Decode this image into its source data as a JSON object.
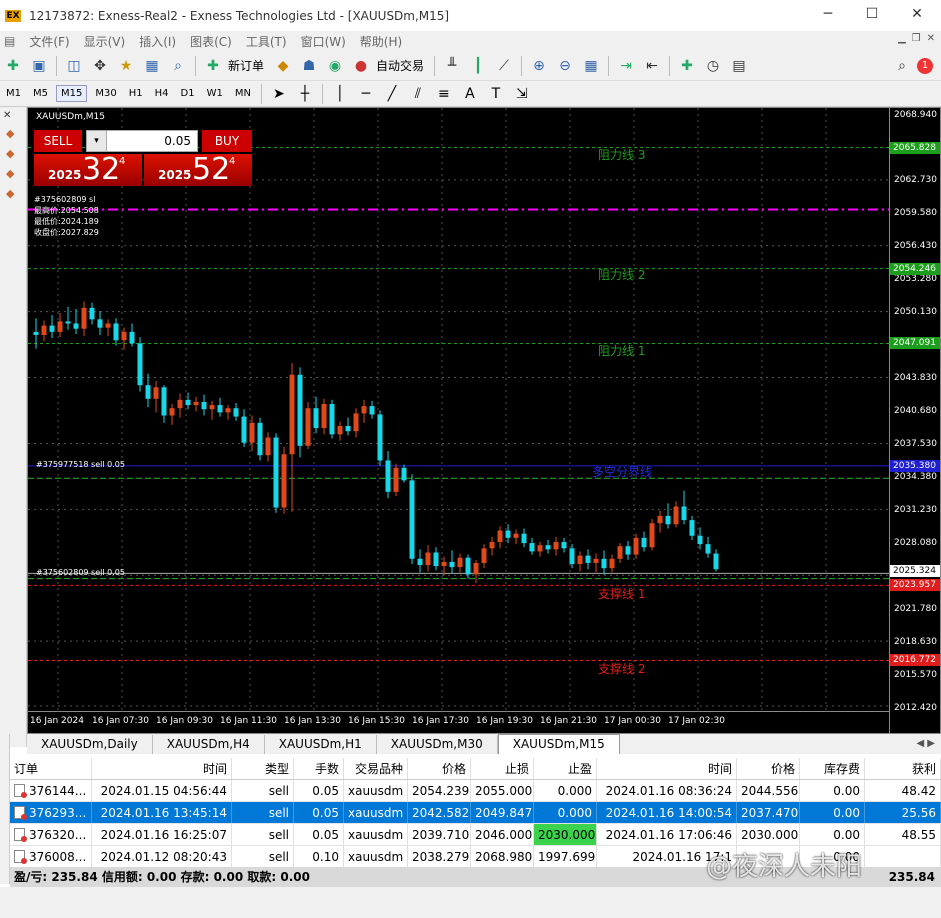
{
  "window": {
    "title": "12173872: Exness-Real2 - Exness Technologies Ltd - [XAUUSDm,M15]",
    "logo": "EX"
  },
  "menu": [
    "文件(F)",
    "显示(V)",
    "插入(I)",
    "图表(C)",
    "工具(T)",
    "窗口(W)",
    "帮助(H)"
  ],
  "toolbar": {
    "new_order": "新订单",
    "auto_trading": "自动交易",
    "notification_badge": "1"
  },
  "timeframes": [
    "M1",
    "M5",
    "M15",
    "M30",
    "H1",
    "H4",
    "D1",
    "W1",
    "MN"
  ],
  "active_timeframe": "M15",
  "chart": {
    "title": "XAUUSDm,M15",
    "trade_panel": {
      "sell_label": "SELL",
      "buy_label": "BUY",
      "lots": "0.05",
      "sell_prefix": "2025",
      "sell_big": "32",
      "sell_sup": "4",
      "buy_prefix": "2025",
      "buy_big": "52",
      "buy_sup": "4"
    },
    "info_lines": [
      "#375602809 sl",
      "最高价:2054.508",
      "最低价:2024.189",
      "收盘价:2027.829"
    ],
    "price_labels": [
      "2068.940",
      "2062.730",
      "2059.580",
      "2056.430",
      "2053.280",
      "2050.130",
      "2043.830",
      "2040.680",
      "2037.530",
      "2034.380",
      "2031.230",
      "2028.080",
      "2021.780",
      "2018.630",
      "2015.570",
      "2012.420"
    ],
    "price_tags": [
      {
        "text": "2065.828",
        "color": "#1c9e1c"
      },
      {
        "text": "2054.246",
        "color": "#1c9e1c"
      },
      {
        "text": "2047.091",
        "color": "#1c9e1c"
      },
      {
        "text": "2035.380",
        "color": "#1e1ed2"
      },
      {
        "text": "2025.324",
        "color": "#ffffff"
      },
      {
        "text": "2023.957",
        "color": "#e01c1c"
      },
      {
        "text": "2016.772",
        "color": "#e01c1c"
      }
    ],
    "time_labels": [
      "16 Jan 2024",
      "16 Jan 07:30",
      "16 Jan 09:30",
      "16 Jan 11:30",
      "16 Jan 13:30",
      "16 Jan 15:30",
      "16 Jan 17:30",
      "16 Jan 19:30",
      "16 Jan 21:30",
      "17 Jan 00:30",
      "17 Jan 02:30"
    ],
    "levels": {
      "r3": "阻力线 3",
      "r2": "阻力线 2",
      "r1": "阻力线 1",
      "pivot": "多空分界线",
      "s1": "支撑线 1",
      "s2": "支撑线 2"
    },
    "order_labels": {
      "o1": "#375977518 sell 0.05",
      "o2": "#375602809 sell 0.05"
    },
    "candles": [
      {
        "o": 2048.2,
        "h": 2049.5,
        "l": 2046.6,
        "c": 2047.9
      },
      {
        "o": 2047.9,
        "h": 2049.3,
        "l": 2047.3,
        "c": 2048.8
      },
      {
        "o": 2048.8,
        "h": 2049.8,
        "l": 2047.6,
        "c": 2048.2
      },
      {
        "o": 2048.2,
        "h": 2050.0,
        "l": 2047.7,
        "c": 2049.2
      },
      {
        "o": 2049.2,
        "h": 2050.6,
        "l": 2048.4,
        "c": 2049.0
      },
      {
        "o": 2049.0,
        "h": 2050.4,
        "l": 2048.0,
        "c": 2048.5
      },
      {
        "o": 2048.5,
        "h": 2051.1,
        "l": 2047.8,
        "c": 2050.5
      },
      {
        "o": 2050.5,
        "h": 2051.0,
        "l": 2048.9,
        "c": 2049.4
      },
      {
        "o": 2049.4,
        "h": 2050.2,
        "l": 2047.9,
        "c": 2048.6
      },
      {
        "o": 2048.6,
        "h": 2049.4,
        "l": 2047.8,
        "c": 2049.0
      },
      {
        "o": 2049.0,
        "h": 2049.5,
        "l": 2046.9,
        "c": 2047.4
      },
      {
        "o": 2047.4,
        "h": 2048.6,
        "l": 2046.5,
        "c": 2048.2
      },
      {
        "o": 2048.2,
        "h": 2049.0,
        "l": 2046.8,
        "c": 2047.1
      },
      {
        "o": 2047.1,
        "h": 2047.7,
        "l": 2042.5,
        "c": 2043.1
      },
      {
        "o": 2043.1,
        "h": 2044.2,
        "l": 2041.0,
        "c": 2041.8
      },
      {
        "o": 2041.8,
        "h": 2043.5,
        "l": 2040.5,
        "c": 2042.9
      },
      {
        "o": 2042.9,
        "h": 2043.1,
        "l": 2039.5,
        "c": 2040.2
      },
      {
        "o": 2040.2,
        "h": 2041.3,
        "l": 2039.3,
        "c": 2040.9
      },
      {
        "o": 2040.9,
        "h": 2042.3,
        "l": 2040.0,
        "c": 2041.7
      },
      {
        "o": 2041.7,
        "h": 2042.4,
        "l": 2040.8,
        "c": 2041.2
      },
      {
        "o": 2041.2,
        "h": 2042.0,
        "l": 2040.6,
        "c": 2041.5
      },
      {
        "o": 2041.5,
        "h": 2042.2,
        "l": 2040.2,
        "c": 2040.8
      },
      {
        "o": 2040.8,
        "h": 2041.6,
        "l": 2039.8,
        "c": 2041.2
      },
      {
        "o": 2041.2,
        "h": 2041.9,
        "l": 2040.1,
        "c": 2040.5
      },
      {
        "o": 2040.5,
        "h": 2041.2,
        "l": 2039.8,
        "c": 2040.9
      },
      {
        "o": 2040.9,
        "h": 2041.4,
        "l": 2039.7,
        "c": 2040.1
      },
      {
        "o": 2040.1,
        "h": 2040.8,
        "l": 2037.2,
        "c": 2037.6
      },
      {
        "o": 2037.6,
        "h": 2040.2,
        "l": 2036.8,
        "c": 2039.5
      },
      {
        "o": 2039.5,
        "h": 2040.0,
        "l": 2035.9,
        "c": 2036.4
      },
      {
        "o": 2036.4,
        "h": 2038.6,
        "l": 2035.8,
        "c": 2038.1
      },
      {
        "o": 2038.1,
        "h": 2038.5,
        "l": 2030.9,
        "c": 2031.4
      },
      {
        "o": 2031.4,
        "h": 2037.2,
        "l": 2030.8,
        "c": 2036.5
      },
      {
        "o": 2036.5,
        "h": 2045.2,
        "l": 2031.0,
        "c": 2044.1
      },
      {
        "o": 2044.1,
        "h": 2044.8,
        "l": 2036.2,
        "c": 2037.3
      },
      {
        "o": 2037.3,
        "h": 2041.5,
        "l": 2037.0,
        "c": 2040.9
      },
      {
        "o": 2040.9,
        "h": 2042.0,
        "l": 2038.5,
        "c": 2039.0
      },
      {
        "o": 2039.0,
        "h": 2041.8,
        "l": 2038.4,
        "c": 2041.3
      },
      {
        "o": 2041.3,
        "h": 2041.7,
        "l": 2038.0,
        "c": 2038.4
      },
      {
        "o": 2038.4,
        "h": 2039.6,
        "l": 2037.8,
        "c": 2039.2
      },
      {
        "o": 2039.2,
        "h": 2040.0,
        "l": 2038.3,
        "c": 2038.7
      },
      {
        "o": 2038.7,
        "h": 2040.9,
        "l": 2038.1,
        "c": 2040.4
      },
      {
        "o": 2040.4,
        "h": 2041.7,
        "l": 2039.5,
        "c": 2041.1
      },
      {
        "o": 2041.1,
        "h": 2041.6,
        "l": 2039.9,
        "c": 2040.3
      },
      {
        "o": 2040.3,
        "h": 2040.7,
        "l": 2035.4,
        "c": 2035.9
      },
      {
        "o": 2035.9,
        "h": 2036.8,
        "l": 2032.3,
        "c": 2032.9
      },
      {
        "o": 2032.9,
        "h": 2035.6,
        "l": 2032.5,
        "c": 2035.2
      },
      {
        "o": 2035.2,
        "h": 2035.5,
        "l": 2033.8,
        "c": 2034.0
      },
      {
        "o": 2034.0,
        "h": 2034.6,
        "l": 2026.0,
        "c": 2026.5
      },
      {
        "o": 2026.5,
        "h": 2027.4,
        "l": 2025.2,
        "c": 2025.9
      },
      {
        "o": 2025.9,
        "h": 2027.8,
        "l": 2025.3,
        "c": 2027.1
      },
      {
        "o": 2027.1,
        "h": 2027.6,
        "l": 2025.4,
        "c": 2025.8
      },
      {
        "o": 2025.8,
        "h": 2026.7,
        "l": 2024.9,
        "c": 2026.2
      },
      {
        "o": 2026.2,
        "h": 2027.3,
        "l": 2025.1,
        "c": 2025.7
      },
      {
        "o": 2025.7,
        "h": 2027.0,
        "l": 2025.2,
        "c": 2026.6
      },
      {
        "o": 2026.6,
        "h": 2026.9,
        "l": 2024.6,
        "c": 2025.0
      },
      {
        "o": 2025.0,
        "h": 2026.4,
        "l": 2024.2,
        "c": 2026.1
      },
      {
        "o": 2026.1,
        "h": 2027.9,
        "l": 2025.6,
        "c": 2027.5
      },
      {
        "o": 2027.5,
        "h": 2028.6,
        "l": 2026.8,
        "c": 2028.1
      },
      {
        "o": 2028.1,
        "h": 2029.6,
        "l": 2027.5,
        "c": 2029.2
      },
      {
        "o": 2029.2,
        "h": 2029.8,
        "l": 2028.0,
        "c": 2028.5
      },
      {
        "o": 2028.5,
        "h": 2029.3,
        "l": 2027.9,
        "c": 2028.9
      },
      {
        "o": 2028.9,
        "h": 2029.4,
        "l": 2027.6,
        "c": 2028.0
      },
      {
        "o": 2028.0,
        "h": 2028.5,
        "l": 2026.9,
        "c": 2027.2
      },
      {
        "o": 2027.2,
        "h": 2028.1,
        "l": 2026.7,
        "c": 2027.8
      },
      {
        "o": 2027.8,
        "h": 2028.3,
        "l": 2027.0,
        "c": 2027.4
      },
      {
        "o": 2027.4,
        "h": 2028.6,
        "l": 2026.8,
        "c": 2028.1
      },
      {
        "o": 2028.1,
        "h": 2028.5,
        "l": 2027.1,
        "c": 2027.5
      },
      {
        "o": 2027.5,
        "h": 2027.9,
        "l": 2025.6,
        "c": 2026.0
      },
      {
        "o": 2026.0,
        "h": 2027.2,
        "l": 2025.3,
        "c": 2026.8
      },
      {
        "o": 2026.8,
        "h": 2027.4,
        "l": 2025.5,
        "c": 2026.1
      },
      {
        "o": 2026.1,
        "h": 2027.0,
        "l": 2025.2,
        "c": 2026.5
      },
      {
        "o": 2026.5,
        "h": 2027.3,
        "l": 2025.0,
        "c": 2025.6
      },
      {
        "o": 2025.6,
        "h": 2026.9,
        "l": 2025.2,
        "c": 2026.5
      },
      {
        "o": 2026.5,
        "h": 2028.0,
        "l": 2026.1,
        "c": 2027.7
      },
      {
        "o": 2027.7,
        "h": 2028.2,
        "l": 2026.4,
        "c": 2026.9
      },
      {
        "o": 2026.9,
        "h": 2028.9,
        "l": 2026.5,
        "c": 2028.5
      },
      {
        "o": 2028.5,
        "h": 2029.1,
        "l": 2027.2,
        "c": 2027.6
      },
      {
        "o": 2027.6,
        "h": 2030.3,
        "l": 2027.3,
        "c": 2029.9
      },
      {
        "o": 2029.9,
        "h": 2031.1,
        "l": 2029.0,
        "c": 2030.6
      },
      {
        "o": 2030.6,
        "h": 2031.8,
        "l": 2029.4,
        "c": 2029.8
      },
      {
        "o": 2029.8,
        "h": 2032.0,
        "l": 2029.5,
        "c": 2031.5
      },
      {
        "o": 2031.5,
        "h": 2033.0,
        "l": 2029.8,
        "c": 2030.2
      },
      {
        "o": 2030.2,
        "h": 2030.6,
        "l": 2028.3,
        "c": 2028.7
      },
      {
        "o": 2028.7,
        "h": 2029.5,
        "l": 2027.4,
        "c": 2027.9
      },
      {
        "o": 2027.9,
        "h": 2028.6,
        "l": 2026.6,
        "c": 2027.0
      },
      {
        "o": 2027.0,
        "h": 2027.4,
        "l": 2025.3,
        "c": 2025.5
      }
    ],
    "colors": {
      "bull": "#e04a1a",
      "bear": "#18d7e8",
      "r": "#1c9e1c",
      "s": "#e01c1c",
      "pivot": "#1e1ed2",
      "hline": "#ff00ff"
    }
  },
  "chart_tabs": [
    "XAUUSDm,Daily",
    "XAUUSDm,H4",
    "XAUUSDm,H1",
    "XAUUSDm,M30",
    "XAUUSDm,M15"
  ],
  "active_chart_tab": "XAUUSDm,M15",
  "orders": {
    "headers": [
      "订单",
      "时间",
      "类型",
      "手数",
      "交易品种",
      "价格",
      "止损",
      "止盈",
      "时间",
      "价格",
      "库存费",
      "获利"
    ],
    "rows": [
      [
        "376144...",
        "2024.01.15 04:56:44",
        "sell",
        "0.05",
        "xauusdm",
        "2054.239",
        "2055.000",
        "0.000",
        "2024.01.16 08:36:24",
        "2044.556",
        "0.00",
        "48.42"
      ],
      [
        "376293...",
        "2024.01.16 13:45:14",
        "sell",
        "0.05",
        "xauusdm",
        "2042.582",
        "2049.847",
        "0.000",
        "2024.01.16 14:00:54",
        "2037.470",
        "0.00",
        "25.56"
      ],
      [
        "376320...",
        "2024.01.16 16:25:07",
        "sell",
        "0.05",
        "xauusdm",
        "2039.710",
        "2046.000",
        "2030.000",
        "2024.01.16 17:06:46",
        "2030.000",
        "0.00",
        "48.55"
      ],
      [
        "376008...",
        "2024.01.12 08:20:43",
        "sell",
        "0.10",
        "xauusdm",
        "2038.279",
        "2068.980",
        "1997.699",
        "2024.01.16 17:1",
        "",
        "0.00",
        ""
      ]
    ],
    "summary": "盈/亏: 235.84  信用额: 0.00  存款: 0.00  取款: 0.00",
    "summary_total": "235.84"
  },
  "watermark": "@夜深人未阳"
}
